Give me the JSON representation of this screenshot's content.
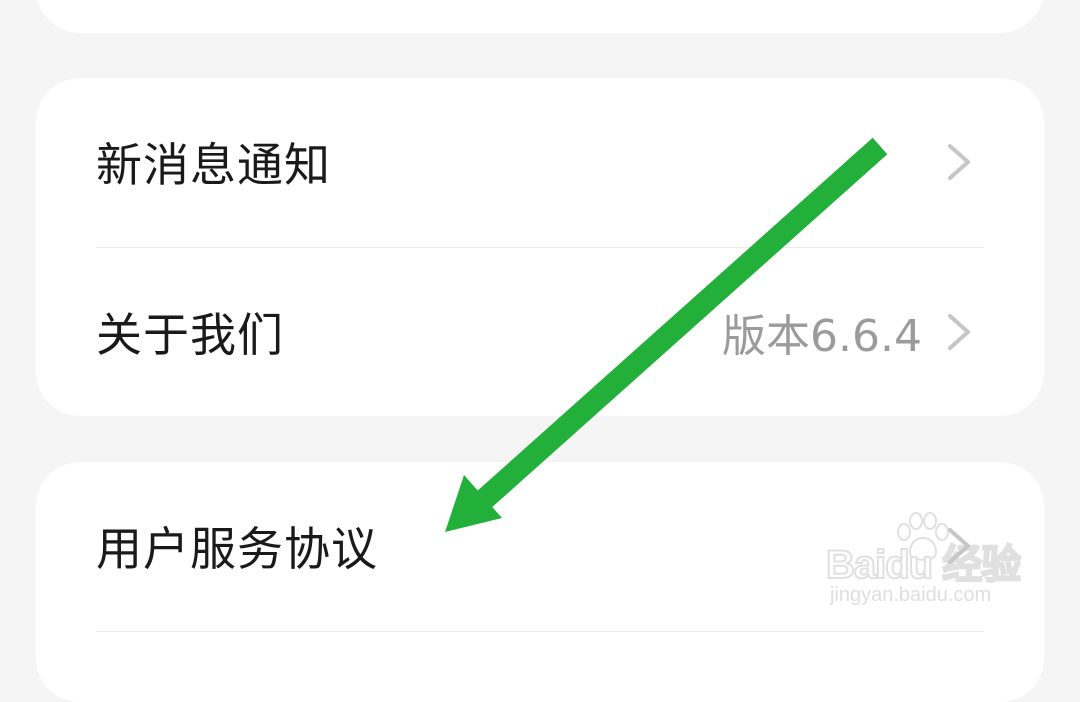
{
  "settings": {
    "rows": [
      {
        "label": "新消息通知",
        "value": ""
      },
      {
        "label": "关于我们",
        "value": "版本6.6.4"
      },
      {
        "label": "用户服务协议",
        "value": ""
      }
    ]
  },
  "watermark": {
    "logo_text": "Baidu 经验",
    "url": "jingyan.baidu.com"
  },
  "annotation": {
    "arrow_color": "#22b03a",
    "icon": "arrow-down-left-icon"
  },
  "colors": {
    "background": "#f5f5f5",
    "card": "#ffffff",
    "label_text": "#1a1a1a",
    "value_text": "#9b9b9b",
    "chevron": "#c6c6c6"
  }
}
